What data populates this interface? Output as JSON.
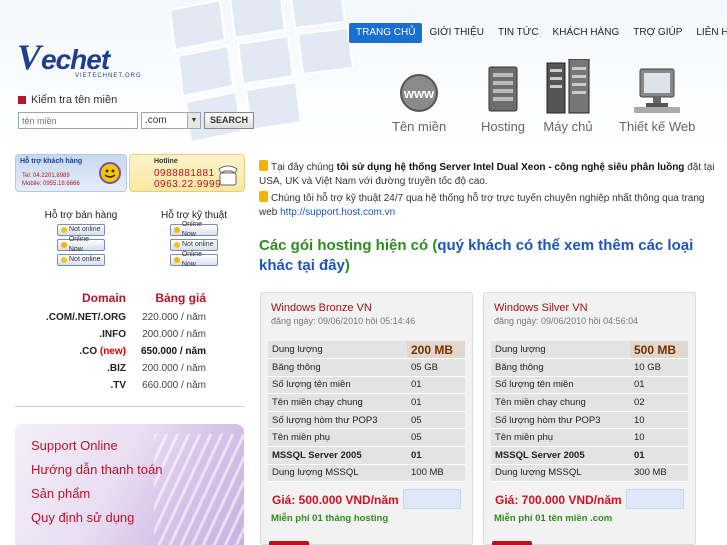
{
  "logo": {
    "mark": "V",
    "name": "echet",
    "tagline": "VIETECHNET.ORG"
  },
  "nav": [
    "TRANG CHỦ",
    "GIỚI THIỆU",
    "TIN TỨC",
    "KHÁCH HÀNG",
    "TRỢ GIÚP",
    "LIÊN HỆ"
  ],
  "domain_search": {
    "title": "Kiểm tra tên miền",
    "placeholder": "tên miền",
    "tld": ".com",
    "button": "SEARCH"
  },
  "services": [
    {
      "label": "Tên miền",
      "icon": "globe-icon"
    },
    {
      "label": "Hosting",
      "icon": "server-icon"
    },
    {
      "label": "Máy chủ",
      "icon": "server-rack-icon"
    },
    {
      "label": "Thiết kế Web",
      "icon": "monitor-icon"
    }
  ],
  "support": {
    "banner_a": {
      "title": "Hỗ trợ khách hàng",
      "tel": "Tel: 04.2201.8989",
      "mobile": "Mobile: 0955.18.6666"
    },
    "banner_b": {
      "title": "Hotline",
      "phone1": "0988881881",
      "phone2": "0963.22.9999"
    },
    "sales": {
      "title": "Hỗ trợ bán hàng",
      "status": [
        "Not online",
        "Online Now",
        "Not online"
      ]
    },
    "tech": {
      "title": "Hỗ trợ kỹ thuật",
      "status": [
        "Online Now",
        "Not online",
        "Online Now"
      ]
    }
  },
  "prices": {
    "col_domain": "Domain",
    "col_price": "Bảng giá",
    "rows": [
      {
        "domain": ".COM/.NET/.ORG",
        "new": "",
        "price": "220.000 / năm"
      },
      {
        "domain": ".INFO",
        "new": "",
        "price": "200.000 / năm"
      },
      {
        "domain": ".CO",
        "new": "(new)",
        "price": "650.000 / năm"
      },
      {
        "domain": ".BIZ",
        "new": "",
        "price": "200.000 / năm"
      },
      {
        "domain": ".TV",
        "new": "",
        "price": "660.000 / năm"
      }
    ]
  },
  "menu": [
    "Support Online",
    "Hướng dẫn thanh toán",
    "Sản phẩm",
    "Quy định sử dụng"
  ],
  "intro": {
    "p1_a": "Tại đây chúng ",
    "p1_b": "tôi sử dụng hệ thống Server Intel Dual Xeon - công nghệ siêu phân luồng",
    "p1_c": " đặt tại USA, UK và Việt Nam với đường truyền tốc độ cao.",
    "p2_a": "Chúng tôi hỗ trợ kỹ thuật 24/7 qua hệ thống hỗ trợ trực tuyến chuyên nghiệp nhất thông qua trang web ",
    "p2_link": "http://support.host.com.vn"
  },
  "hosting_title": {
    "a": "Các gói hosting hiện có (",
    "b": "quý khách có thể xem thêm các loại khác tại đây",
    "c": ")"
  },
  "packages": [
    {
      "name": "Windows Bronze VN",
      "date": "đăng ngày: 09/06/2010 hồi 05:14:46",
      "rows": [
        {
          "k": "Dung lượng",
          "v": "200 MB"
        },
        {
          "k": "Băng thông",
          "v": "05 GB"
        },
        {
          "k": "Số lượng tên miền",
          "v": "01"
        },
        {
          "k": "Tên miền chạy chung",
          "v": "01"
        },
        {
          "k": "Số lượng hòm thư POP3",
          "v": "05"
        },
        {
          "k": "Tên miền phụ",
          "v": "05"
        },
        {
          "k": "MSSQL Server 2005",
          "v": "01"
        },
        {
          "k": "Dung lượng MSSQL",
          "v": "100 MB"
        }
      ],
      "price": "Giá: 500.000 VND/năm",
      "promo": "Miễn phí 01 tháng hosting"
    },
    {
      "name": "Windows Silver VN",
      "date": "đăng ngày: 09/06/2010 hồi 04:56:04",
      "rows": [
        {
          "k": "Dung lượng",
          "v": "500 MB"
        },
        {
          "k": "Băng thông",
          "v": "10 GB"
        },
        {
          "k": "Số lượng tên miền",
          "v": "01"
        },
        {
          "k": "Tên miền chạy chung",
          "v": "02"
        },
        {
          "k": "Số lượng hòm thư POP3",
          "v": "10"
        },
        {
          "k": "Tên miền phụ",
          "v": "10"
        },
        {
          "k": "MSSQL Server 2005",
          "v": "01"
        },
        {
          "k": "Dung lượng MSSQL",
          "v": "300 MB"
        }
      ],
      "price": "Giá: 700.000 VND/năm",
      "promo": "Miễn phí 01 tên miền .com"
    }
  ],
  "colors": {
    "brand": "#1d3f8c",
    "accent_red": "#b9142a",
    "nav_active": "#1b6fd1",
    "green": "#2e8b1e"
  }
}
